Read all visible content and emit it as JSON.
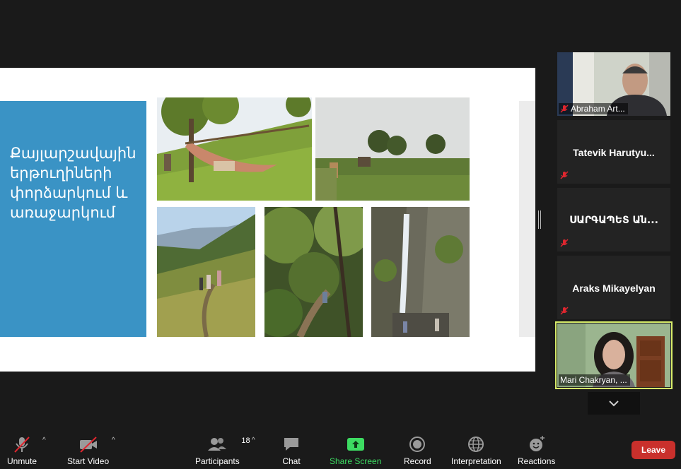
{
  "slide": {
    "title_lines": [
      "Քայլարշավային",
      "երթուղիների",
      "փորձարկում և",
      "առաջարկում"
    ]
  },
  "participants": {
    "tiles": [
      {
        "name": "Abraham Art...",
        "video": true,
        "muted": true
      },
      {
        "name": "Tatevik  Harutyu...",
        "video": false,
        "muted": true
      },
      {
        "name": "ՍԱՐԳԱՊԵՏ Ան...",
        "video": false,
        "muted": true
      },
      {
        "name": "Araks Mikayelyan",
        "video": false,
        "muted": true
      },
      {
        "name": "Mari Chakryan, ...",
        "video": true,
        "muted": false,
        "active_speaker": true
      }
    ]
  },
  "toolbar": {
    "unmute_label": "Unmute",
    "start_video_label": "Start Video",
    "participants_label": "Participants",
    "participants_count": "18",
    "chat_label": "Chat",
    "share_screen_label": "Share Screen",
    "record_label": "Record",
    "interpretation_label": "Interpretation",
    "reactions_label": "Reactions",
    "leave_label": "Leave"
  },
  "colors": {
    "background": "#1a1a1a",
    "slide_panel": "#3a93c5",
    "active_speaker_border": "#d7ec6a",
    "share_screen": "#3ddc62",
    "leave": "#c9302c",
    "muted_icon": "#e0262f"
  },
  "icons": {
    "mic_muted": "mic-muted-icon",
    "video_off": "video-off-icon",
    "participants": "people-icon",
    "chat": "chat-bubble-icon",
    "share": "share-up-arrow-icon",
    "record": "record-icon",
    "interpretation": "globe-icon",
    "reactions": "smiley-plus-icon",
    "scroll": "chevron-down-icon"
  }
}
